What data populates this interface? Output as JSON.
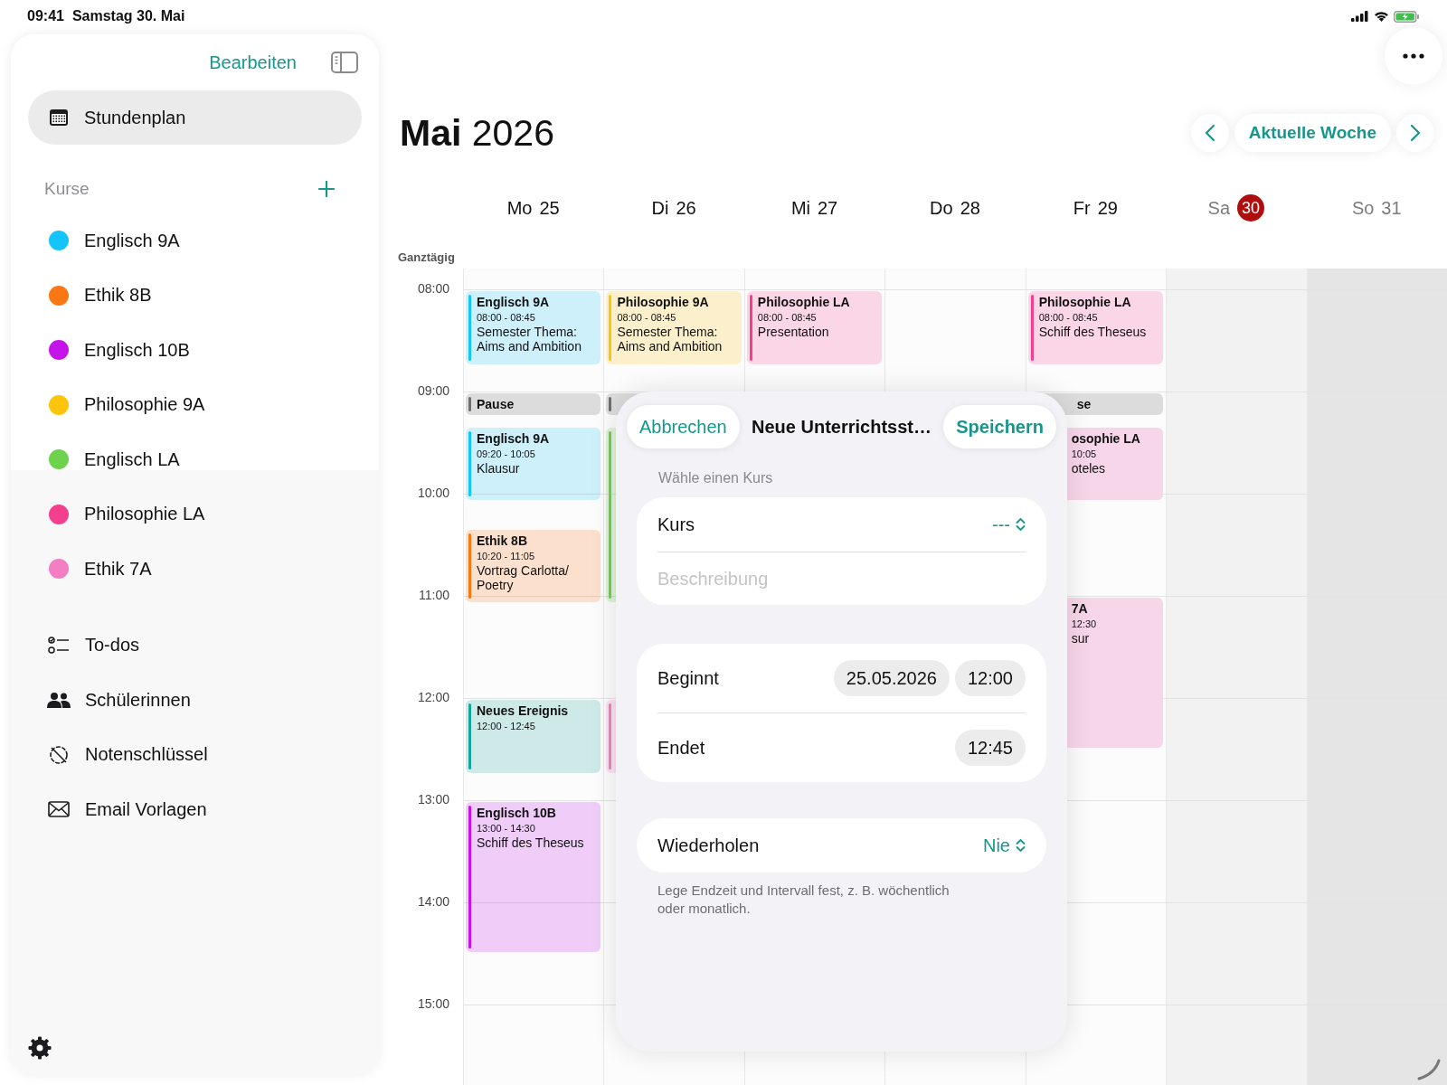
{
  "status_bar": {
    "time": "09:41",
    "date": "Samstag 30. Mai"
  },
  "sidebar": {
    "edit": "Bearbeiten",
    "main_item": {
      "label": "Stundenplan",
      "selected": true
    },
    "courses_header": "Kurse",
    "courses": [
      {
        "name": "Englisch 9A",
        "color": "#14c4fa"
      },
      {
        "name": "Ethik 8B",
        "color": "#fa7814"
      },
      {
        "name": "Englisch 10B",
        "color": "#c414ea"
      },
      {
        "name": "Philosophie 9A",
        "color": "#fcc40a"
      },
      {
        "name": "Englisch LA",
        "color": "#6dd24c"
      },
      {
        "name": "Philosophie LA",
        "color": "#f43f8f"
      },
      {
        "name": "Ethik 7A",
        "color": "#f47ec3"
      }
    ],
    "nav_items": [
      {
        "label": "To-dos",
        "kind": "checklist"
      },
      {
        "label": "Schülerinnen",
        "kind": "people"
      },
      {
        "label": "Notenschlüssel",
        "kind": "noscore"
      },
      {
        "label": "Email Vorlagen",
        "kind": "mail"
      }
    ]
  },
  "calendar": {
    "title": "**Mai** 2026",
    "current_week": "Aktuelle Woche",
    "all_day_label": "Ganztägig",
    "days": [
      {
        "weekday": "Mo",
        "date": "25",
        "weekend": false,
        "today": false
      },
      {
        "weekday": "Di",
        "date": "26",
        "weekend": false,
        "today": false
      },
      {
        "weekday": "Mi",
        "date": "27",
        "weekend": false,
        "today": false
      },
      {
        "weekday": "Do",
        "date": "28",
        "weekend": false,
        "today": false
      },
      {
        "weekday": "Fr",
        "date": "29",
        "weekend": false,
        "today": false
      },
      {
        "weekday": "Sa",
        "date": "30",
        "weekend": true,
        "today": true
      },
      {
        "weekday": "So",
        "date": "31",
        "weekend": true,
        "today": false
      }
    ],
    "hours": [
      "08:00",
      "09:00",
      "10:00",
      "11:00",
      "12:00",
      "13:00",
      "14:00",
      "15:00"
    ],
    "events": [
      {
        "kind": "lesson",
        "title": "Englisch 9A",
        "time": "08:00 - 08:45",
        "note": "Semester Thema: Aims and Ambition",
        "color": "#14c4fa"
      },
      {
        "kind": "pause",
        "title": "Pause"
      },
      {
        "kind": "lesson",
        "title": "Englisch 9A",
        "time": "09:20 - 10:05",
        "note": "Klausur",
        "color": "#14c4fa"
      },
      {
        "kind": "lesson",
        "title": "Ethik 8B",
        "time": "10:20 - 11:05",
        "note": "Vortrag Carlotta/ Poetry",
        "color": "#fa7814"
      },
      {
        "kind": "lesson",
        "title": "Neues Ereignis",
        "time": "12:00 - 12:45",
        "color": "#17a59b"
      },
      {
        "kind": "lesson",
        "title": "Englisch 10B",
        "time": "13:00 - 14:30",
        "note": "Schiff des Theseus",
        "color": "#c414ea"
      },
      {
        "kind": "lesson",
        "title": "Philosophie 9A",
        "time": "08:00 - 08:45",
        "note": "Semester Thema: Aims and Ambition",
        "color": "#fcc40a"
      },
      {
        "kind": "pause"
      },
      {
        "kind": "lesson",
        "color": "#6dd24c"
      },
      {
        "kind": "lesson",
        "color": "#f47ec3"
      },
      {
        "kind": "lesson",
        "title": "Philosophie LA",
        "time": "08:00 - 08:45",
        "note": "Presentation",
        "color": "#f43f8f"
      },
      {
        "kind": "lesson",
        "title": "Philosophie LA",
        "time": "08:00 - 08:45",
        "note": "Schiff des Theseus",
        "color": "#f43f8f"
      },
      {
        "kind": "pause",
        "title": "se"
      },
      {
        "kind": "lesson",
        "title": "osophie LA",
        "time": "10:05",
        "note": "oteles"
      },
      {
        "kind": "lesson",
        "title": "7A",
        "time": "12:30",
        "note": "sur"
      }
    ]
  },
  "dialog": {
    "cancel": "Abbrechen",
    "title": "Neue Unterrichtsst…",
    "save": "Speichern",
    "section_label": "Wähle einen Kurs",
    "course": {
      "label": "Kurs",
      "value": "---"
    },
    "description": {
      "placeholder": "Beschreibung"
    },
    "start": {
      "label": "Beginnt",
      "date": "25.05.2026",
      "time": "12:00"
    },
    "end": {
      "label": "Endet",
      "time": "12:45"
    },
    "repeat": {
      "label": "Wiederholen",
      "value": "Nie"
    },
    "footnote": "Lege Endzeit und Intervall fest, z. B. wöchentlich oder monatlich."
  }
}
